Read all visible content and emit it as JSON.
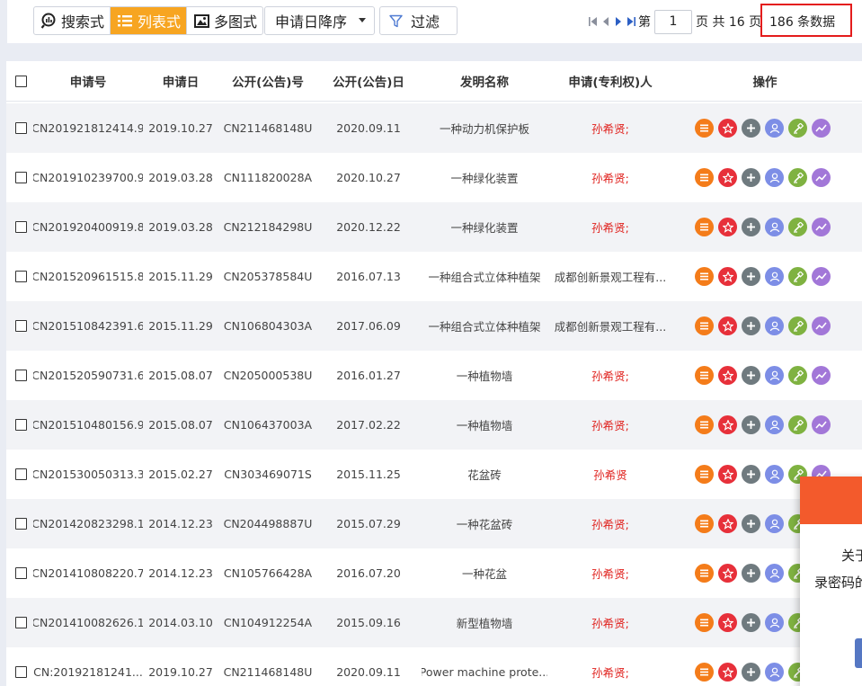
{
  "toolbar": {
    "views": [
      {
        "label": "搜索式",
        "icon": "search-chart-icon",
        "active": false
      },
      {
        "label": "列表式",
        "icon": "list-icon",
        "active": true
      },
      {
        "label": "多图式",
        "icon": "image-icon",
        "active": false
      }
    ],
    "sort_label": "申请日降序",
    "filter_label": "过滤"
  },
  "pager": {
    "prefix": "第",
    "page_value": "1",
    "total_text": "页 共 16 页",
    "count_text": "186 条数据"
  },
  "table": {
    "headers": [
      "申请号",
      "申请日",
      "公开(公告)号",
      "公开(公告)日",
      "发明名称",
      "申请(专利权)人",
      "操作"
    ],
    "rows": [
      {
        "app_no": "CN201921812414.9",
        "app_date": "2019.10.27",
        "pub_no": "CN211468148U",
        "pub_date": "2020.09.11",
        "title": "一种动力机保护板",
        "applicant": "孙希贤;",
        "applicant_red": true
      },
      {
        "app_no": "CN201910239700.9",
        "app_date": "2019.03.28",
        "pub_no": "CN111820028A",
        "pub_date": "2020.10.27",
        "title": "一种绿化装置",
        "applicant": "孙希贤;",
        "applicant_red": true
      },
      {
        "app_no": "CN201920400919.8",
        "app_date": "2019.03.28",
        "pub_no": "CN212184298U",
        "pub_date": "2020.12.22",
        "title": "一种绿化装置",
        "applicant": "孙希贤;",
        "applicant_red": true
      },
      {
        "app_no": "CN201520961515.8",
        "app_date": "2015.11.29",
        "pub_no": "CN205378584U",
        "pub_date": "2016.07.13",
        "title": "一种组合式立体种植架",
        "applicant": "成都创新景观工程有...",
        "applicant_red": false
      },
      {
        "app_no": "CN201510842391.6",
        "app_date": "2015.11.29",
        "pub_no": "CN106804303A",
        "pub_date": "2017.06.09",
        "title": "一种组合式立体种植架",
        "applicant": "成都创新景观工程有...",
        "applicant_red": false
      },
      {
        "app_no": "CN201520590731.6",
        "app_date": "2015.08.07",
        "pub_no": "CN205000538U",
        "pub_date": "2016.01.27",
        "title": "一种植物墙",
        "applicant": "孙希贤;",
        "applicant_red": true
      },
      {
        "app_no": "CN201510480156.9",
        "app_date": "2015.08.07",
        "pub_no": "CN106437003A",
        "pub_date": "2017.02.22",
        "title": "一种植物墙",
        "applicant": "孙希贤;",
        "applicant_red": true
      },
      {
        "app_no": "CN201530050313.3",
        "app_date": "2015.02.27",
        "pub_no": "CN303469071S",
        "pub_date": "2015.11.25",
        "title": "花盆砖",
        "applicant": "孙希贤",
        "applicant_red": true
      },
      {
        "app_no": "CN201420823298.1",
        "app_date": "2014.12.23",
        "pub_no": "CN204498887U",
        "pub_date": "2015.07.29",
        "title": "一种花盆砖",
        "applicant": "孙希贤;",
        "applicant_red": true
      },
      {
        "app_no": "CN201410808220.7",
        "app_date": "2014.12.23",
        "pub_no": "CN105766428A",
        "pub_date": "2016.07.20",
        "title": "一种花盆",
        "applicant": "孙希贤;",
        "applicant_red": true
      },
      {
        "app_no": "CN201410082626.1",
        "app_date": "2014.03.10",
        "pub_no": "CN104912254A",
        "pub_date": "2015.09.16",
        "title": "新型植物墙",
        "applicant": "孙希贤;",
        "applicant_red": true
      },
      {
        "app_no": "CN:20192181241...",
        "app_date": "2019.10.27",
        "pub_no": "CN211468148U",
        "pub_date": "2020.09.11",
        "title": "Power machine prote...",
        "applicant": "孙希贤;",
        "applicant_red": true
      }
    ]
  },
  "action_icons": [
    "list-detail-icon",
    "star-icon",
    "plus-icon",
    "user-icon",
    "legal-status-icon",
    "trend-icon"
  ],
  "popup": {
    "line1": "关于",
    "line2": "录密码的"
  },
  "colors": {
    "accent": "#f7a521",
    "highlight_border": "#e41c1c",
    "applicant_red": "#e0211d",
    "popup_header": "#f35a2c"
  }
}
